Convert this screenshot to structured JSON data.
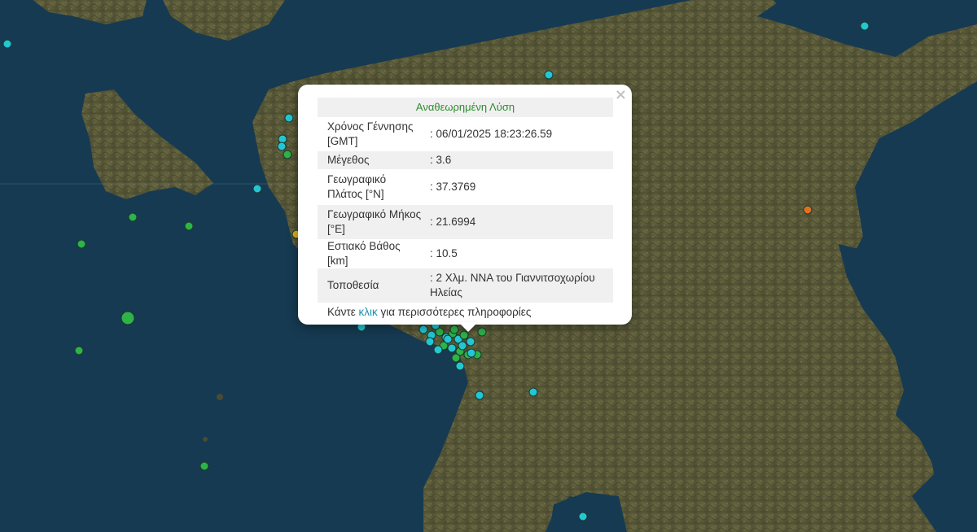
{
  "map": {
    "colors": {
      "sea": "#163a52",
      "land": "#5b5a3a",
      "selected": "#2a6"
    },
    "markers": [
      {
        "c": "#22c7d6"
      },
      {
        "c": "#22c7d6"
      },
      {
        "c": "#22c7d6"
      },
      {
        "c": "#22c7d6"
      },
      {
        "c": "#22c7d6"
      },
      {
        "c": "#22c7d6"
      },
      {
        "c": "#2db34a"
      },
      {
        "c": "#2db34a"
      },
      {
        "c": "#2db34a"
      },
      {
        "c": "#2db34a"
      },
      {
        "c": "#2db34a"
      },
      {
        "c": "#2db34a"
      },
      {
        "c": "#2db34a"
      },
      {
        "c": "#e07020"
      },
      {
        "c": "#e0b020"
      },
      {
        "c": "#22c7d6"
      },
      {
        "c": "#22c7d6"
      },
      {
        "c": "#22c7d6"
      },
      {
        "c": "#22c7d6"
      },
      {
        "c": "#22c7d6"
      },
      {
        "c": "#22c7d6"
      }
    ]
  },
  "popup": {
    "close_label": "×",
    "title": "Αναθεωρημένη Λύση",
    "rows": [
      {
        "key": "Χρόνος Γέννησης [GMT]",
        "value": ": 06/01/2025 18:23:26.59"
      },
      {
        "key": "Μέγεθος",
        "value": ": 3.6"
      },
      {
        "key": "Γεωγραφικό Πλάτος [°N]",
        "value": ": 37.3769"
      },
      {
        "key": "Γεωγραφικό Μήκος [°E]",
        "value": ": 21.6994"
      },
      {
        "key": "Εστιακό Βάθος [km]",
        "value": ": 10.5"
      },
      {
        "key": "Τοποθεσία",
        "value": ": 2 Χλμ. ΝΝΑ του Γιαννιτσοχωρίου Ηλείας"
      }
    ],
    "more_prefix": "Κάντε ",
    "more_link": "κλικ",
    "more_suffix": " για περισσότερες πληροφορίες"
  }
}
